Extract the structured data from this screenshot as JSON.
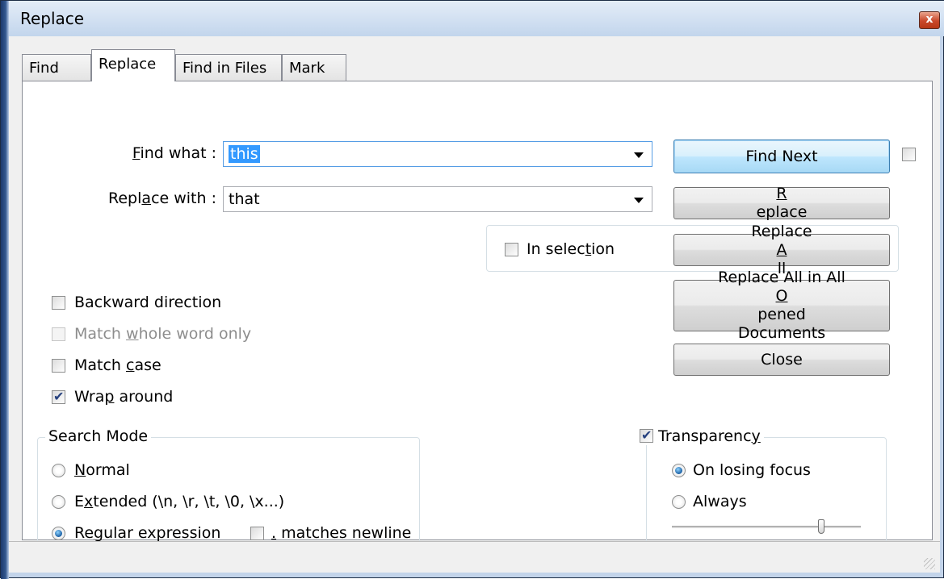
{
  "window": {
    "title": "Replace",
    "close_glyph": "x"
  },
  "tabs": [
    {
      "label": "Find"
    },
    {
      "label": "Replace"
    },
    {
      "label": "Find in Files"
    },
    {
      "label": "Mark"
    }
  ],
  "find": {
    "label_key": "F",
    "label_rest": "ind what :",
    "value": "this"
  },
  "replace": {
    "label_pre": "Repl",
    "label_key": "a",
    "label_post": "ce with :",
    "value": "that"
  },
  "buttons": {
    "find_next": "Find Next",
    "replace_key": "R",
    "replace_rest": "eplace",
    "replace_all_pre": "Replace ",
    "replace_all_key": "A",
    "replace_all_post": "ll",
    "replace_all_docs_pre": "Replace All in All ",
    "replace_all_docs_key": "O",
    "replace_all_docs_post": "pened",
    "replace_all_docs_line2": "Documents",
    "close": "Close"
  },
  "in_selection": {
    "pre": "In selec",
    "key": "t",
    "post": "ion",
    "checked": false
  },
  "options": {
    "backward": {
      "label": "Backward direction",
      "checked": false
    },
    "whole_word": {
      "pre": "Match ",
      "key": "w",
      "post": "hole word only",
      "checked": false,
      "enabled": false
    },
    "match_case": {
      "pre": "Match ",
      "key": "c",
      "post": "ase",
      "checked": false
    },
    "wrap": {
      "pre": "Wra",
      "key": "p",
      "post": " around",
      "checked": true
    }
  },
  "search_mode": {
    "title": "Search Mode",
    "normal": {
      "key": "N",
      "post": "ormal",
      "selected": false
    },
    "extended": {
      "pre": "E",
      "key": "x",
      "post": "tended (\\n, \\r, \\t, \\0, \\x...)",
      "selected": false
    },
    "regex": {
      "pre": "Re",
      "key": "g",
      "post": "ular expression",
      "selected": true
    },
    "dot_newline": {
      "key": ".",
      "post": " matches newline",
      "checked": false
    }
  },
  "transparency": {
    "pre": "Transparenc",
    "key": "y",
    "checked": true,
    "on_losing_focus": {
      "label": "On losing focus",
      "selected": true
    },
    "always": {
      "label": "Always",
      "selected": false
    },
    "level_fraction": 0.8
  }
}
